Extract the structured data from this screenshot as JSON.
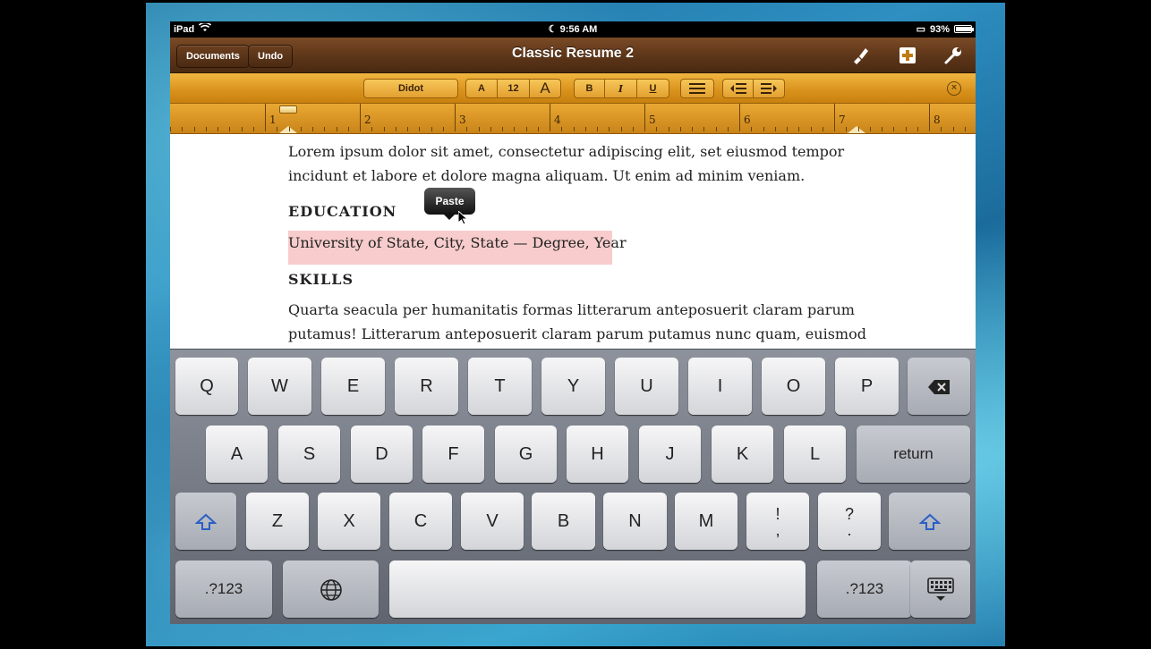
{
  "status_bar": {
    "carrier": "iPad",
    "time": "9:56 AM",
    "battery": "93%",
    "battery_level": 0.93
  },
  "title_bar": {
    "documents_label": "Documents",
    "undo_label": "Undo",
    "title": "Classic Resume 2"
  },
  "format_bar": {
    "font_name": "Didot",
    "font_smaller": "A",
    "font_size": "12",
    "font_larger": "A",
    "bold": "B",
    "italic": "I",
    "underline": "U"
  },
  "ruler": {
    "numbers": [
      "1",
      "2",
      "3",
      "4",
      "5",
      "6",
      "7",
      "8"
    ]
  },
  "document": {
    "line1": "Lorem ipsum dolor sit amet, consectetur adipiscing elit, set eiusmod tempor",
    "line2": "incidunt et labore et dolore magna aliquam. Ut enim ad minim veniam.",
    "education_heading": "EDUCATION",
    "education_line": "University of State, City, State — Degree, Year",
    "skills_heading": "SKILLS",
    "skills_line1": "Quarta seacula per humanitatis formas litterarum anteposuerit claram parum",
    "skills_line2": "putamus! Litterarum anteposuerit claram parum putamus nunc quam, euismod",
    "paste_label": "Paste"
  },
  "keyboard": {
    "row1": [
      "Q",
      "W",
      "E",
      "R",
      "T",
      "Y",
      "U",
      "I",
      "O",
      "P"
    ],
    "row2": [
      "A",
      "S",
      "D",
      "F",
      "G",
      "H",
      "J",
      "K",
      "L"
    ],
    "return_label": "return",
    "row3": [
      "Z",
      "X",
      "C",
      "V",
      "B",
      "N",
      "M"
    ],
    "punct1_top": "!",
    "punct1_bottom": ",",
    "punct2_top": "?",
    "punct2_bottom": ".",
    "numbers_label": ".?123"
  }
}
